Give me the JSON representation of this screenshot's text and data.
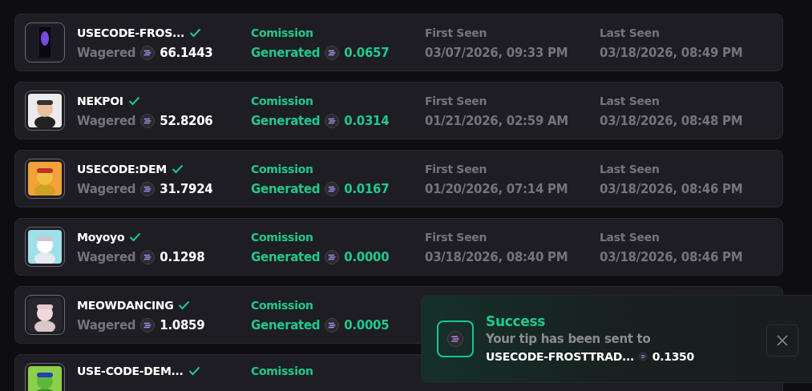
{
  "rows": [
    {
      "name": "USECODE-FROS...",
      "verified": true,
      "wagered_label": "Wagered",
      "wagered": "66.1443",
      "commission_label": "Comission",
      "generated_label": "Generated",
      "generated": "0.0657",
      "first_seen_label": "First Seen",
      "first_seen": "03/07/2026, 09:33 PM",
      "last_seen_label": "Last Seen",
      "last_seen": "03/18/2026, 08:49 PM"
    },
    {
      "name": "NEKPOI",
      "verified": true,
      "wagered_label": "Wagered",
      "wagered": "52.8206",
      "commission_label": "Comission",
      "generated_label": "Generated",
      "generated": "0.0314",
      "first_seen_label": "First Seen",
      "first_seen": "01/21/2026, 02:59 AM",
      "last_seen_label": "Last Seen",
      "last_seen": "03/18/2026, 08:48 PM"
    },
    {
      "name": "USECODE:DEM",
      "verified": true,
      "wagered_label": "Wagered",
      "wagered": "31.7924",
      "commission_label": "Comission",
      "generated_label": "Generated",
      "generated": "0.0167",
      "first_seen_label": "First Seen",
      "first_seen": "01/20/2026, 07:14 PM",
      "last_seen_label": "Last Seen",
      "last_seen": "03/18/2026, 08:46 PM"
    },
    {
      "name": "Moyoyo",
      "verified": true,
      "wagered_label": "Wagered",
      "wagered": "0.1298",
      "commission_label": "Comission",
      "generated_label": "Generated",
      "generated": "0.0000",
      "first_seen_label": "First Seen",
      "first_seen": "03/18/2026, 08:40 PM",
      "last_seen_label": "Last Seen",
      "last_seen": "03/18/2026, 08:46 PM"
    },
    {
      "name": "MEOWDANCING",
      "verified": true,
      "wagered_label": "Wagered",
      "wagered": "1.0859",
      "commission_label": "Comission",
      "generated_label": "Generated",
      "generated": "0.0005"
    },
    {
      "name": "USE-CODE-DEM...",
      "verified": true,
      "commission_label": "Comission"
    }
  ],
  "toast": {
    "title": "Success",
    "message": "Your tip has been sent to",
    "recipient": "USECODE-FROSTTRAD...",
    "amount": "0.1350"
  }
}
